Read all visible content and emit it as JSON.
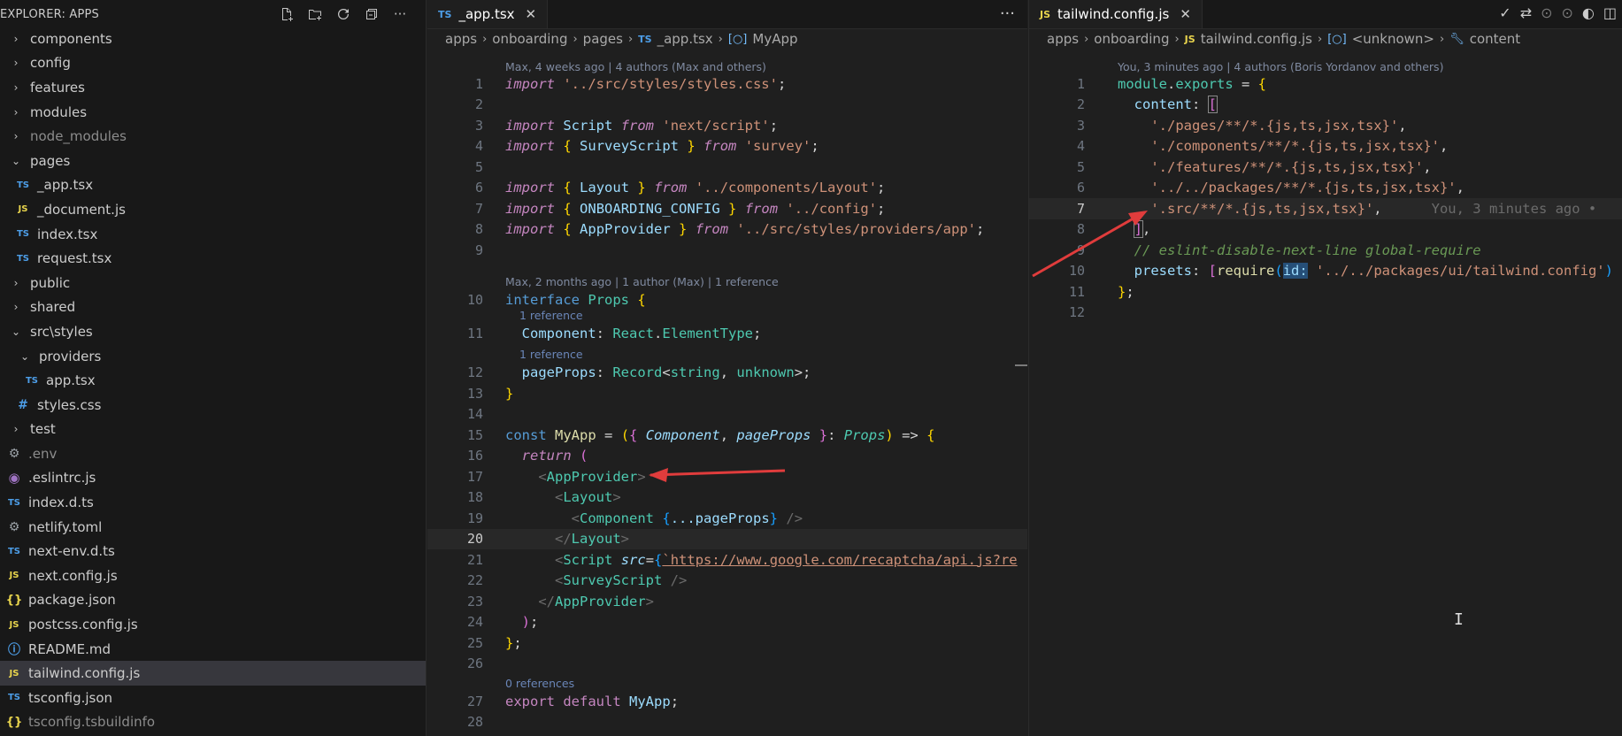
{
  "explorer": {
    "title": "EXPLORER: APPS",
    "actions": [
      "new-file-icon",
      "new-folder-icon",
      "refresh-icon",
      "collapse-icon",
      "more-icon"
    ],
    "items": [
      {
        "label": "components",
        "kind": "folder"
      },
      {
        "label": "config",
        "kind": "folder"
      },
      {
        "label": "features",
        "kind": "folder"
      },
      {
        "label": "modules",
        "kind": "folder"
      },
      {
        "label": "node_modules",
        "kind": "folder"
      },
      {
        "label": "pages",
        "kind": "folder-open"
      },
      {
        "label": "_app.tsx",
        "kind": "ts"
      },
      {
        "label": "_document.js",
        "kind": "js"
      },
      {
        "label": "index.tsx",
        "kind": "ts"
      },
      {
        "label": "request.tsx",
        "kind": "ts"
      },
      {
        "label": "public",
        "kind": "folder"
      },
      {
        "label": "shared",
        "kind": "folder"
      },
      {
        "label": "src\\styles",
        "kind": "folder-open"
      },
      {
        "label": "providers",
        "kind": "folder-open"
      },
      {
        "label": "app.tsx",
        "kind": "ts"
      },
      {
        "label": "styles.css",
        "kind": "css"
      },
      {
        "label": "test",
        "kind": "folder"
      },
      {
        "label": ".env",
        "kind": "gear"
      },
      {
        "label": ".eslintrc.js",
        "kind": "eslint"
      },
      {
        "label": "index.d.ts",
        "kind": "ts"
      },
      {
        "label": "netlify.toml",
        "kind": "gear"
      },
      {
        "label": "next-env.d.ts",
        "kind": "ts"
      },
      {
        "label": "next.config.js",
        "kind": "js"
      },
      {
        "label": "package.json",
        "kind": "json"
      },
      {
        "label": "postcss.config.js",
        "kind": "js"
      },
      {
        "label": "README.md",
        "kind": "info"
      },
      {
        "label": "tailwind.config.js",
        "kind": "js"
      },
      {
        "label": "tsconfig.json",
        "kind": "ts"
      },
      {
        "label": "tsconfig.tsbuildinfo",
        "kind": "json"
      }
    ],
    "file_badges": {
      "ts": "TS",
      "js": "JS",
      "css": "#",
      "json": "{}"
    }
  },
  "left_editor": {
    "tab": {
      "lang": "TS",
      "label": "_app.tsx"
    },
    "more": "···",
    "breadcrumbs": [
      "apps",
      "onboarding",
      "pages",
      "_app.tsx",
      "MyApp"
    ],
    "lenses": {
      "l1": "Max, 4 weeks ago | 4 authors (Max and others)",
      "l10": "Max, 2 months ago | 1 author (Max) | 1 reference",
      "l11": "1 reference",
      "l12": "1 reference",
      "l27": "0 references"
    },
    "line_numbers": [
      "1",
      "2",
      "3",
      "4",
      "5",
      "6",
      "7",
      "8",
      "9",
      "10",
      "11",
      "12",
      "13",
      "14",
      "15",
      "16",
      "17",
      "18",
      "19",
      "20",
      "21",
      "22",
      "23",
      "24",
      "25",
      "26",
      "27",
      "28"
    ],
    "code": {
      "import": "import",
      "from": "from",
      "interface": "interface",
      "const": "const",
      "return": "return",
      "export": "export",
      "default": "default",
      "s_styles": "'../src/styles/styles.css'",
      "Script": "Script",
      "s_next_script": "'next/script'",
      "SurveyScript": "SurveyScript",
      "s_survey": "'survey'",
      "Layout": "Layout",
      "s_layout": "'../components/Layout'",
      "ONBOARDING_CONFIG": "ONBOARDING_CONFIG",
      "s_config": "'../config'",
      "AppProvider": "AppProvider",
      "s_provider": "'../src/styles/providers/app'",
      "Props": "Props",
      "Component": "Component",
      "React": "React",
      "ElementType": "ElementType",
      "pageProps": "pageProps",
      "Record": "Record",
      "string": "string",
      "unknown": "unknown",
      "MyApp": "MyApp",
      "src": "src",
      "spread": "...pageProps",
      "url": "`https://www.google.com/recaptcha/api.js?re"
    }
  },
  "right_editor": {
    "tab": {
      "lang": "JS",
      "label": "tailwind.config.js"
    },
    "toolbar": [
      "check-icon",
      "git-compare-icon",
      "prev-change-icon",
      "next-change-icon",
      "timeline-icon",
      "split-editor-icon",
      "more-icon"
    ],
    "breadcrumbs": [
      "apps",
      "onboarding",
      "tailwind.config.js",
      "<unknown>",
      "content"
    ],
    "lens_top": "You, 3 minutes ago | 4 authors (Boris Yordanov and others)",
    "line_numbers": [
      "1",
      "2",
      "3",
      "4",
      "5",
      "6",
      "7",
      "8",
      "9",
      "10",
      "11",
      "12"
    ],
    "code": {
      "module": "module",
      "exports": "exports",
      "content": "content",
      "p_pages": "'./pages/**/*.{js,ts,jsx,tsx}'",
      "p_components": "'./components/**/*.{js,ts,jsx,tsx}'",
      "p_features": "'./features/**/*.{js,ts,jsx,tsx}'",
      "p_packages": "'../../packages/**/*.{js,ts,jsx,tsx}'",
      "p_src": "'.src/**/*.{js,ts,jsx,tsx}'",
      "blame": "You, 3 minutes ago •",
      "comment": "// eslint-disable-next-line global-require",
      "presets": "presets",
      "require": "require",
      "id_hint": "id:",
      "p_ui": "'../../packages/ui/tailwind.config'"
    }
  },
  "colors": {
    "annotation_arrow": "#e03c3c",
    "editor_bg": "#1f1f1f",
    "sidebar_bg": "#181818",
    "selection_bg": "#37373d"
  }
}
